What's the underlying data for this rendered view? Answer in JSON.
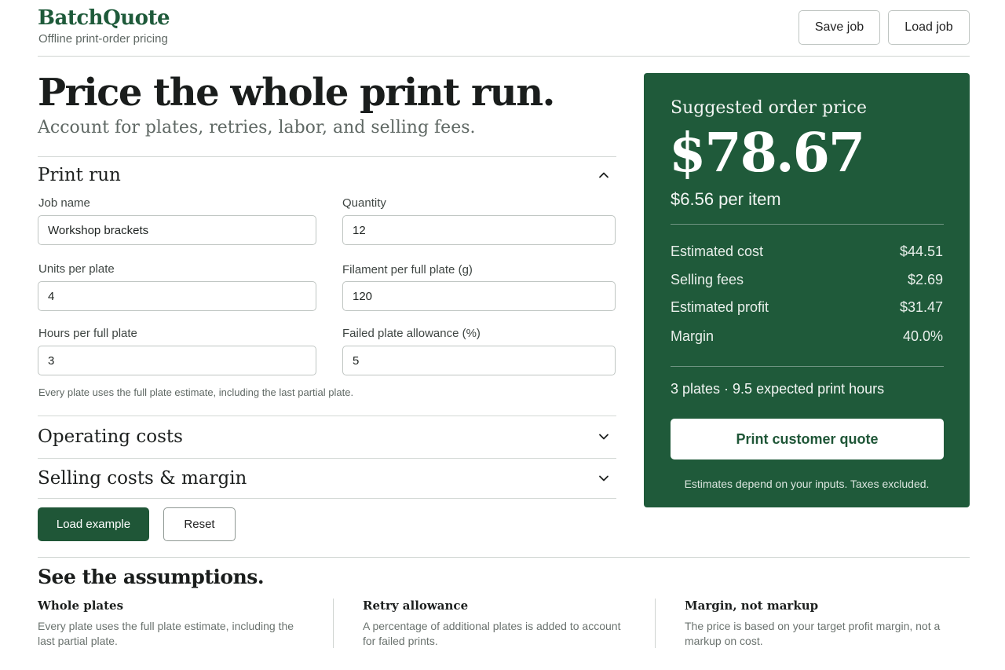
{
  "header": {
    "brand": "BatchQuote",
    "tagline": "Offline print-order pricing",
    "save_label": "Save job",
    "load_label": "Load job"
  },
  "hero": {
    "title": "Price the whole print run.",
    "subtitle": "Account for plates, retries, labor, and selling fees."
  },
  "print_run": {
    "title": "Print run",
    "expanded": true,
    "fields": {
      "job_name": {
        "label": "Job name",
        "value": "Workshop brackets"
      },
      "quantity": {
        "label": "Quantity",
        "value": "12"
      },
      "units_per_plate": {
        "label": "Units per plate",
        "value": "4"
      },
      "filament": {
        "label": "Filament per full plate (g)",
        "value": "120"
      },
      "hours": {
        "label": "Hours per full plate",
        "value": "3"
      },
      "failed": {
        "label": "Failed plate allowance (%)",
        "value": "5"
      }
    },
    "help": "Every plate uses the full plate estimate, including the last partial plate."
  },
  "sections": {
    "operating": {
      "title": "Operating costs",
      "expanded": false
    },
    "selling": {
      "title": "Selling costs & margin",
      "expanded": false
    }
  },
  "actions": {
    "load_example": "Load example",
    "reset": "Reset"
  },
  "quote": {
    "label": "Suggested order price",
    "price": "$78.67",
    "per_item": "$6.56 per item",
    "rows": [
      {
        "label": "Estimated cost",
        "value": "$44.51"
      },
      {
        "label": "Selling fees",
        "value": "$2.69"
      },
      {
        "label": "Estimated profit",
        "value": "$31.47"
      },
      {
        "label": "Margin",
        "value": "40.0%"
      }
    ],
    "summary": "3 plates · 9.5 expected print hours",
    "print_button": "Print customer quote",
    "note": "Estimates depend on your inputs. Taxes excluded.",
    "colors": {
      "panel": "#1f5a3a",
      "accent": "#1f5637"
    }
  },
  "assumptions": {
    "title": "See the assumptions.",
    "items": [
      {
        "title": "Whole plates",
        "text": "Every plate uses the full plate estimate, including the last partial plate."
      },
      {
        "title": "Retry allowance",
        "text": "A percentage of additional plates is added to account for failed prints."
      },
      {
        "title": "Margin, not markup",
        "text": "The price is based on your target profit margin, not a markup on cost."
      }
    ]
  },
  "icons": {
    "expanded": "chevron-up-icon",
    "collapsed": "chevron-down-icon"
  }
}
